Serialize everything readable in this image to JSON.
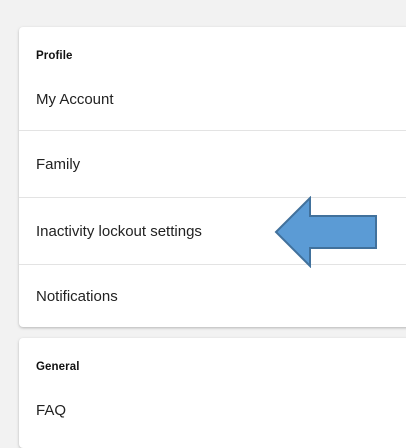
{
  "profile": {
    "header": "Profile",
    "items": [
      {
        "label": "My Account"
      },
      {
        "label": "Family"
      },
      {
        "label": "Inactivity lockout settings"
      },
      {
        "label": "Notifications"
      }
    ]
  },
  "general": {
    "header": "General",
    "items": [
      {
        "label": "FAQ"
      }
    ]
  },
  "annotation": {
    "arrow_color": "#5b9bd5",
    "arrow_stroke": "#41719c",
    "icon": "left-arrow-icon"
  }
}
